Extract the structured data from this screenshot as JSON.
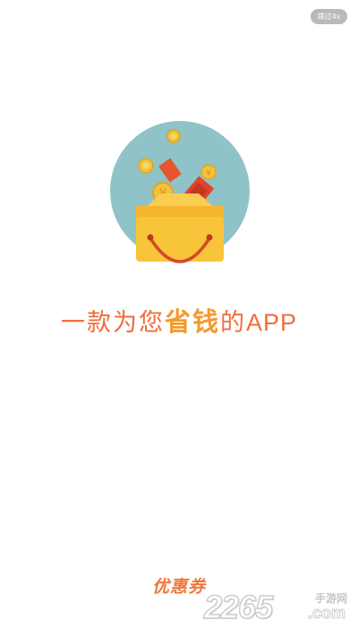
{
  "skip": {
    "label": "跳过4s"
  },
  "slogan": {
    "part1": "一款为您",
    "highlight": "省钱",
    "part2": "的",
    "app": "APP"
  },
  "brand": {
    "name": "优惠券"
  },
  "watermark": {
    "number": "2265",
    "site": "手游网",
    "suffix": ".com"
  },
  "colors": {
    "accent": "#f26c3a",
    "highlight": "#f39a2c",
    "circle": "#8fc3c7",
    "bag": "#f8c43a",
    "coin": "#f2c23c",
    "ticket": "#e8542c"
  },
  "icons": [
    "coin-icon",
    "ticket-icon",
    "shopping-bag-icon"
  ]
}
